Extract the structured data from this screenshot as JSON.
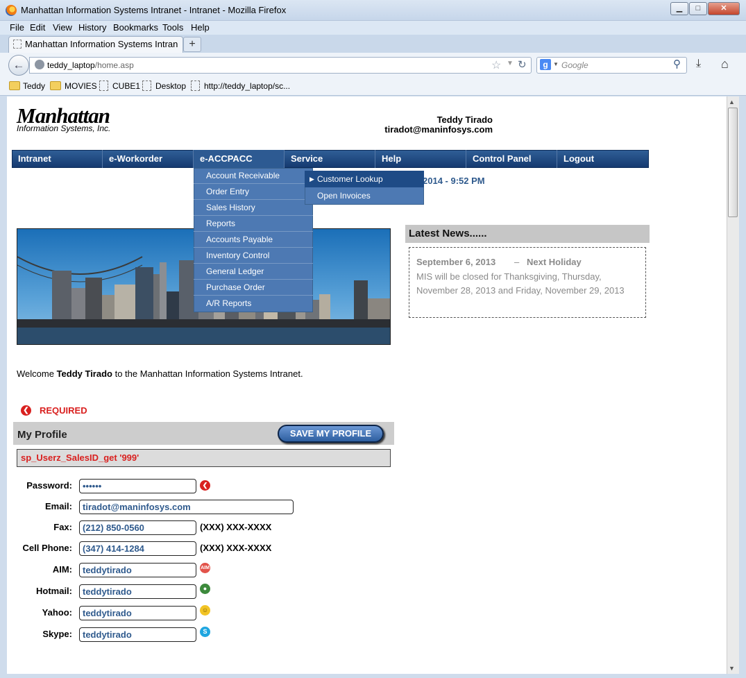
{
  "window": {
    "title": "Manhattan Information Systems Intranet - Intranet - Mozilla Firefox",
    "min_glyph": "▁",
    "max_glyph": "□",
    "close_glyph": "✕"
  },
  "menu": [
    "File",
    "Edit",
    "View",
    "History",
    "Bookmarks",
    "Tools",
    "Help"
  ],
  "tab": {
    "label": "Manhattan Information Systems Intranet...",
    "new_tab": "+"
  },
  "address": {
    "host": "teddy_laptop",
    "path": "/home.asp"
  },
  "search": {
    "engine_glyph": "g",
    "placeholder": "Google"
  },
  "bookmarks": [
    "Teddy",
    "MOVIES",
    "CUBE1",
    "Desktop",
    "http://teddy_laptop/sc..."
  ],
  "page": {
    "logo_line1": "Manhattan",
    "logo_line2": "Information Systems, Inc.",
    "user_name": "Teddy Tirado",
    "user_email": "tiradot@maninfosys.com",
    "nav": [
      "Intranet",
      "e-Workorder",
      "e-ACCPACC",
      "Service",
      "Help",
      "Control Panel",
      "Logout"
    ],
    "dropdown": [
      "Account Receivable",
      "Order Entry",
      "Sales History",
      "Reports",
      "Accounts Payable",
      "Inventory Control",
      "General Ledger",
      "Purchase Order",
      "A/R Reports"
    ],
    "submenu": [
      "Customer Lookup",
      "Open Invoices"
    ],
    "datetime": "2014 - 9:52 PM",
    "news": {
      "header": "Latest News......",
      "date": "September 6, 2013",
      "separator": "–",
      "title": "Next Holiday",
      "body": "MIS will be closed for Thanksgiving, Thursday, November 28, 2013 and Friday, November 29, 2013"
    },
    "welcome": {
      "prefix": "Welcome ",
      "name": "Teddy Tirado",
      "suffix": " to the Manhattan Information Systems Intranet."
    },
    "required": "REQUIRED",
    "profile": {
      "title": "My Profile",
      "save_label": "SAVE MY PROFILE",
      "sp_text": "sp_Userz_SalesID_get '999'",
      "fields": [
        {
          "label": "Password:",
          "value": "••••••"
        },
        {
          "label": "Email:",
          "value": "tiradot@maninfosys.com"
        },
        {
          "label": "Fax:",
          "value": "(212) 850-0560",
          "hint": "(XXX) XXX-XXXX"
        },
        {
          "label": "Cell Phone:",
          "value": "(347) 414-1284",
          "hint": "(XXX) XXX-XXXX"
        },
        {
          "label": "AIM:",
          "value": "teddytirado"
        },
        {
          "label": "Hotmail:",
          "value": "teddytirado"
        },
        {
          "label": "Yahoo:",
          "value": "teddytirado"
        },
        {
          "label": "Skype:",
          "value": "teddytirado"
        }
      ]
    }
  },
  "colors": {
    "nav_blue": "#1f4a80",
    "dropdown_blue": "#4d79b3",
    "required_red": "#d9201f",
    "field_text": "#2f5a8d"
  }
}
